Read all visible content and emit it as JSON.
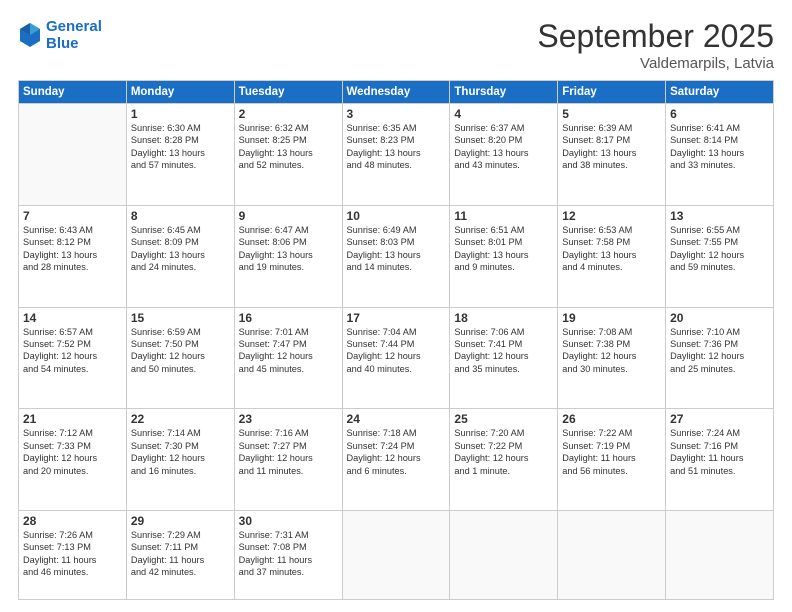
{
  "header": {
    "logo_line1": "General",
    "logo_line2": "Blue",
    "month": "September 2025",
    "location": "Valdemarpils, Latvia"
  },
  "weekdays": [
    "Sunday",
    "Monday",
    "Tuesday",
    "Wednesday",
    "Thursday",
    "Friday",
    "Saturday"
  ],
  "weeks": [
    [
      {
        "day": "",
        "info": ""
      },
      {
        "day": "1",
        "info": "Sunrise: 6:30 AM\nSunset: 8:28 PM\nDaylight: 13 hours\nand 57 minutes."
      },
      {
        "day": "2",
        "info": "Sunrise: 6:32 AM\nSunset: 8:25 PM\nDaylight: 13 hours\nand 52 minutes."
      },
      {
        "day": "3",
        "info": "Sunrise: 6:35 AM\nSunset: 8:23 PM\nDaylight: 13 hours\nand 48 minutes."
      },
      {
        "day": "4",
        "info": "Sunrise: 6:37 AM\nSunset: 8:20 PM\nDaylight: 13 hours\nand 43 minutes."
      },
      {
        "day": "5",
        "info": "Sunrise: 6:39 AM\nSunset: 8:17 PM\nDaylight: 13 hours\nand 38 minutes."
      },
      {
        "day": "6",
        "info": "Sunrise: 6:41 AM\nSunset: 8:14 PM\nDaylight: 13 hours\nand 33 minutes."
      }
    ],
    [
      {
        "day": "7",
        "info": "Sunrise: 6:43 AM\nSunset: 8:12 PM\nDaylight: 13 hours\nand 28 minutes."
      },
      {
        "day": "8",
        "info": "Sunrise: 6:45 AM\nSunset: 8:09 PM\nDaylight: 13 hours\nand 24 minutes."
      },
      {
        "day": "9",
        "info": "Sunrise: 6:47 AM\nSunset: 8:06 PM\nDaylight: 13 hours\nand 19 minutes."
      },
      {
        "day": "10",
        "info": "Sunrise: 6:49 AM\nSunset: 8:03 PM\nDaylight: 13 hours\nand 14 minutes."
      },
      {
        "day": "11",
        "info": "Sunrise: 6:51 AM\nSunset: 8:01 PM\nDaylight: 13 hours\nand 9 minutes."
      },
      {
        "day": "12",
        "info": "Sunrise: 6:53 AM\nSunset: 7:58 PM\nDaylight: 13 hours\nand 4 minutes."
      },
      {
        "day": "13",
        "info": "Sunrise: 6:55 AM\nSunset: 7:55 PM\nDaylight: 12 hours\nand 59 minutes."
      }
    ],
    [
      {
        "day": "14",
        "info": "Sunrise: 6:57 AM\nSunset: 7:52 PM\nDaylight: 12 hours\nand 54 minutes."
      },
      {
        "day": "15",
        "info": "Sunrise: 6:59 AM\nSunset: 7:50 PM\nDaylight: 12 hours\nand 50 minutes."
      },
      {
        "day": "16",
        "info": "Sunrise: 7:01 AM\nSunset: 7:47 PM\nDaylight: 12 hours\nand 45 minutes."
      },
      {
        "day": "17",
        "info": "Sunrise: 7:04 AM\nSunset: 7:44 PM\nDaylight: 12 hours\nand 40 minutes."
      },
      {
        "day": "18",
        "info": "Sunrise: 7:06 AM\nSunset: 7:41 PM\nDaylight: 12 hours\nand 35 minutes."
      },
      {
        "day": "19",
        "info": "Sunrise: 7:08 AM\nSunset: 7:38 PM\nDaylight: 12 hours\nand 30 minutes."
      },
      {
        "day": "20",
        "info": "Sunrise: 7:10 AM\nSunset: 7:36 PM\nDaylight: 12 hours\nand 25 minutes."
      }
    ],
    [
      {
        "day": "21",
        "info": "Sunrise: 7:12 AM\nSunset: 7:33 PM\nDaylight: 12 hours\nand 20 minutes."
      },
      {
        "day": "22",
        "info": "Sunrise: 7:14 AM\nSunset: 7:30 PM\nDaylight: 12 hours\nand 16 minutes."
      },
      {
        "day": "23",
        "info": "Sunrise: 7:16 AM\nSunset: 7:27 PM\nDaylight: 12 hours\nand 11 minutes."
      },
      {
        "day": "24",
        "info": "Sunrise: 7:18 AM\nSunset: 7:24 PM\nDaylight: 12 hours\nand 6 minutes."
      },
      {
        "day": "25",
        "info": "Sunrise: 7:20 AM\nSunset: 7:22 PM\nDaylight: 12 hours\nand 1 minute."
      },
      {
        "day": "26",
        "info": "Sunrise: 7:22 AM\nSunset: 7:19 PM\nDaylight: 11 hours\nand 56 minutes."
      },
      {
        "day": "27",
        "info": "Sunrise: 7:24 AM\nSunset: 7:16 PM\nDaylight: 11 hours\nand 51 minutes."
      }
    ],
    [
      {
        "day": "28",
        "info": "Sunrise: 7:26 AM\nSunset: 7:13 PM\nDaylight: 11 hours\nand 46 minutes."
      },
      {
        "day": "29",
        "info": "Sunrise: 7:29 AM\nSunset: 7:11 PM\nDaylight: 11 hours\nand 42 minutes."
      },
      {
        "day": "30",
        "info": "Sunrise: 7:31 AM\nSunset: 7:08 PM\nDaylight: 11 hours\nand 37 minutes."
      },
      {
        "day": "",
        "info": ""
      },
      {
        "day": "",
        "info": ""
      },
      {
        "day": "",
        "info": ""
      },
      {
        "day": "",
        "info": ""
      }
    ]
  ]
}
